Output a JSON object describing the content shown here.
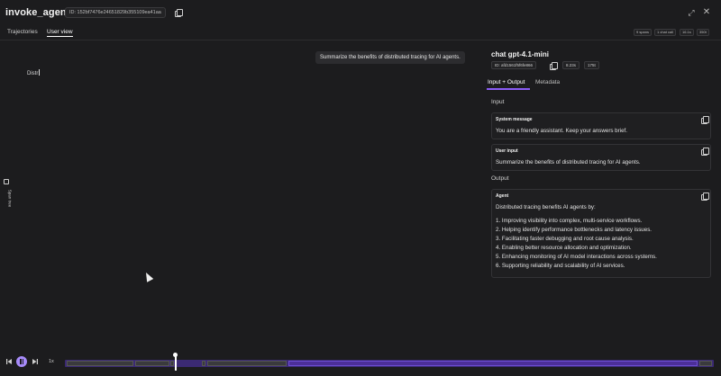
{
  "header": {
    "title": "invoke_agent",
    "trace_id": "ID: 152bf7476e24651829b355109ea41aa"
  },
  "tabs": [
    {
      "label": "Trajectories"
    },
    {
      "label": "User view"
    }
  ],
  "stats": [
    "9 spans",
    "1 chat call",
    "16.1s",
    "350t"
  ],
  "sidebar": {
    "label": "Span tree"
  },
  "chat": {
    "user_message": "Summarize the benefits of distributed tracing for AI agents.",
    "typed_text": "Distr"
  },
  "panel": {
    "span_title": "chat gpt-4.1-mini",
    "span_id": "ID: afd1561f5f6fe866",
    "duration": "8.23s",
    "tokens": "175t",
    "tabs": [
      {
        "label": "Input + Output"
      },
      {
        "label": "Metadata"
      }
    ],
    "input_label": "Input",
    "output_label": "Output",
    "system": {
      "head": "System message",
      "body": "You are a friendly assistant. Keep your answers brief."
    },
    "user": {
      "head": "User input",
      "body": "Summarize the benefits of distributed tracing for AI agents."
    },
    "agent": {
      "head": "Agent",
      "intro": "Distributed tracing benefits AI agents by:",
      "items": [
        "1. Improving visibility into complex, multi-service workflows.",
        "2. Helping identify performance bottlenecks and latency issues.",
        "3. Facilitating faster debugging and root cause analysis.",
        "4. Enabling better resource allocation and optimization.",
        "5. Enhancing monitoring of AI model interactions across systems.",
        "6. Supporting reliability and scalability of AI services."
      ]
    }
  },
  "playback": {
    "speed": "1x",
    "accent": "#a78bfa"
  }
}
